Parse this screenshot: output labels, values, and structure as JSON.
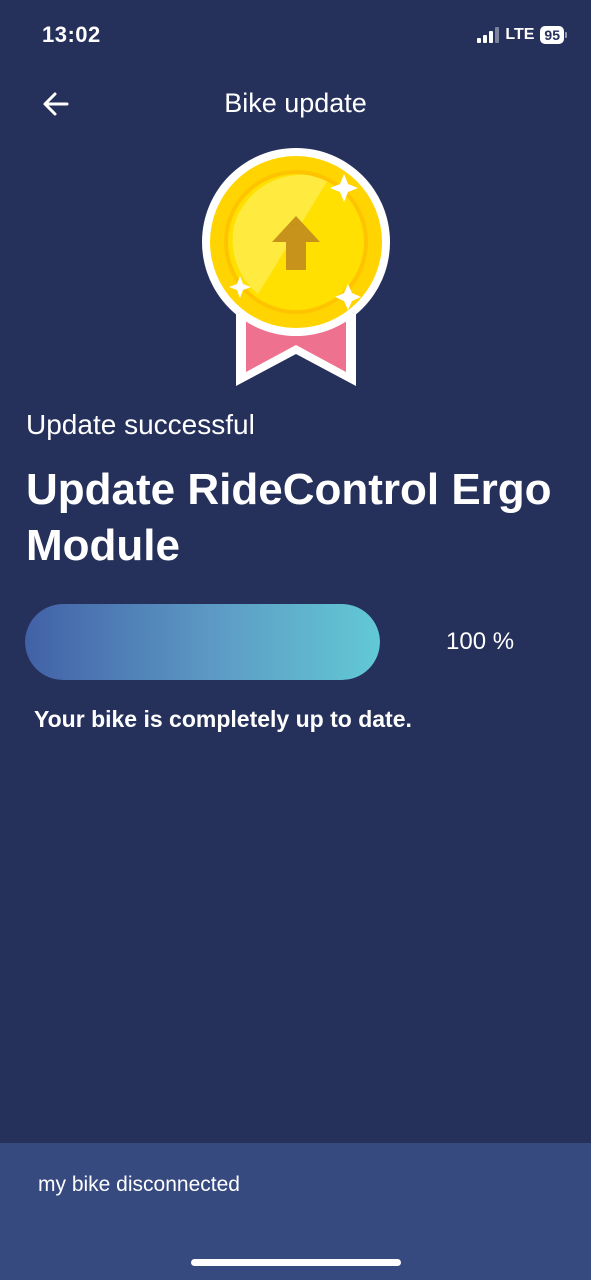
{
  "status_bar": {
    "time": "13:02",
    "network": "LTE",
    "battery": "95"
  },
  "header": {
    "title": "Bike update",
    "back_icon": "arrow-left-icon"
  },
  "badge": {
    "icon": "upload-arrow-medal-icon",
    "colors": {
      "coin": "#ffd400",
      "ribbon": "#ee7190"
    }
  },
  "update": {
    "status": "Update successful",
    "module_title": "Update RideControl Ergo Module",
    "progress": 1.0,
    "progress_label": "100 %",
    "message": "Your bike is completely up to date."
  },
  "footer": {
    "connection_status": "my bike disconnected"
  },
  "colors": {
    "background": "#26315b",
    "footer_background": "#374a80",
    "progress_start": "#4261a7",
    "progress_end": "#62c9d5"
  }
}
